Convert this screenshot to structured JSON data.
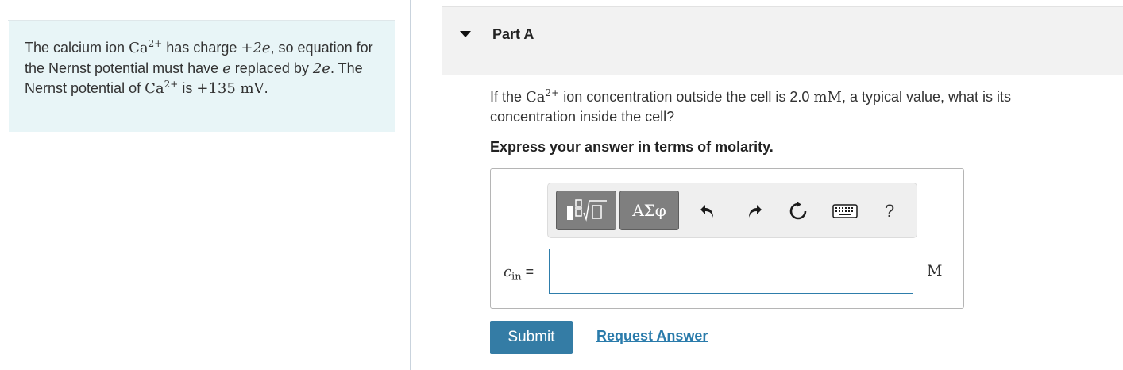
{
  "hint": {
    "t1": "The calcium ion ",
    "ion_base": "Ca",
    "ion_charge": "2+",
    "t2": " has charge ",
    "charge_expr": "+2e",
    "t3": ", so equation for the Nernst potential must have ",
    "e_var": "e",
    "t4": " replaced by ",
    "two_e": "2e",
    "t5": ". The Nernst potential of ",
    "ion2_base": "Ca",
    "ion2_charge": "2+",
    "t6": " is ",
    "potential": "+135 mV",
    "t7": "."
  },
  "part": {
    "title": "Part A"
  },
  "question": {
    "t1": "If the ",
    "ion_base": "Ca",
    "ion_charge": "2+",
    "t2": " ion concentration outside the cell is 2.0 ",
    "unit": "mM",
    "t3": ", a typical value, what is its concentration inside the cell?"
  },
  "instruction": "Express your answer in terms of molarity.",
  "toolbar": {
    "greek_label": "ΑΣφ",
    "help_label": "?",
    "icons": [
      "templates-icon",
      "undo-icon",
      "redo-icon",
      "reset-icon",
      "keyboard-icon",
      "help-icon"
    ]
  },
  "answer": {
    "variable_base": "c",
    "variable_sub": "in",
    "equals": "=",
    "value": "",
    "unit": "M"
  },
  "actions": {
    "submit_label": "Submit",
    "request_label": "Request Answer"
  },
  "colors": {
    "hint_background": "#e8f5f7",
    "header_background": "#f2f2f2",
    "submit_background": "#347ca5",
    "link": "#2a7bab",
    "input_border": "#2e7dab"
  }
}
